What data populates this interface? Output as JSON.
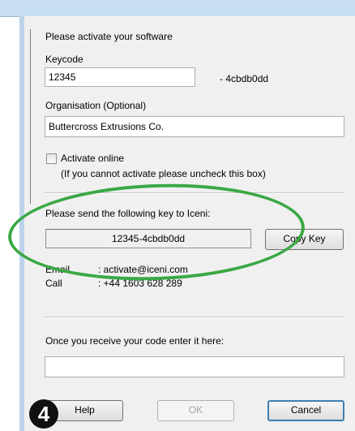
{
  "dialog": {
    "intro": "Please activate your software",
    "keycode_label": "Keycode",
    "keycode_value": "12345",
    "keycode_suffix": "- 4cbdb0dd",
    "organisation_label": "Organisation (Optional)",
    "organisation_value": "Buttercross Extrusions Co.",
    "activate_online_label": "Activate online",
    "activate_online_hint": "(If you cannot activate please uncheck this box)",
    "activate_online_checked": false,
    "send_key_label": "Please send the following key to Iceni:",
    "activation_key": "12345-4cbdb0dd",
    "copy_key_button": "Copy Key",
    "email_label": "Email",
    "email_value": ": activate@iceni.com",
    "call_label": "Call",
    "call_value": ": +44 1603 628 289",
    "receive_code_label": "Once you receive your code enter it here:",
    "code_value": "",
    "buttons": {
      "help": "Help",
      "ok": "OK",
      "cancel": "Cancel"
    }
  },
  "annotation": {
    "step_number": "4",
    "highlight_color": "#3aa845"
  }
}
